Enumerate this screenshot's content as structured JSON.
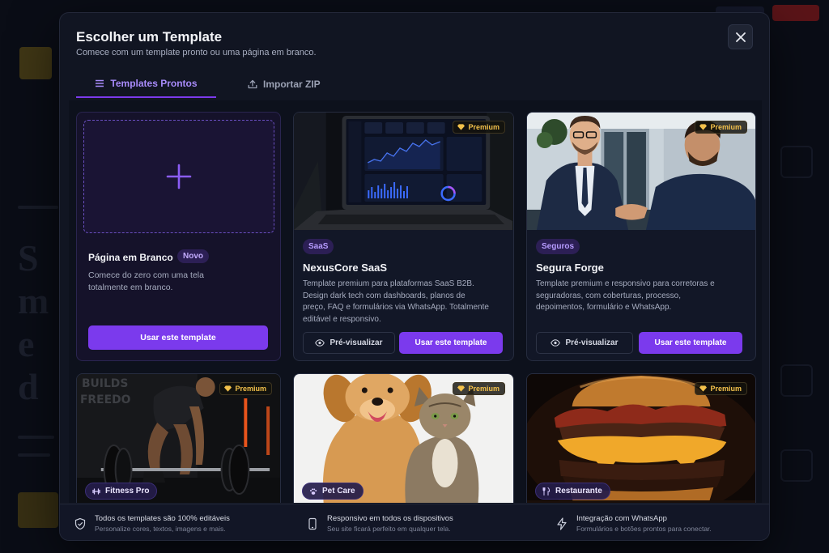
{
  "modal": {
    "title": "Escolher um Template",
    "subtitle": "Comece com um template pronto ou uma página em branco."
  },
  "tabs": [
    {
      "label": "Templates Prontos",
      "active": true,
      "icon": "list-icon"
    },
    {
      "label": "Importar ZIP",
      "active": false,
      "icon": "upload-icon"
    }
  ],
  "blank": {
    "title": "Página em Branco",
    "badge": "Novo",
    "description": "Comece do zero com uma tela totalmente em branco.",
    "button": "Usar este template"
  },
  "premium_label": "Premium",
  "cards": [
    {
      "category": "SaaS",
      "name": "NexusCore SaaS",
      "description": "Template premium para plataformas SaaS B2B. Design dark tech com dashboards, planos de preço, FAQ e formulários via WhatsApp. Totalmente editável e responsivo.",
      "preview": "Pré-visualizar",
      "use": "Usar este template"
    },
    {
      "category": "Seguros",
      "name": "Segura Forge",
      "description": "Template premium e responsivo para corretoras e seguradoras, com coberturas, processo, depoimentos, formulário e WhatsApp.",
      "preview": "Pré-visualizar",
      "use": "Usar este template"
    }
  ],
  "bottom_cards": [
    {
      "category": "Fitness Pro",
      "icon": "dumbbell-icon",
      "thumb_text": [
        "BUILDS",
        "FREEDO"
      ]
    },
    {
      "category": "Pet Care",
      "icon": "paw-icon"
    },
    {
      "category": "Restaurante",
      "icon": "utensils-icon"
    }
  ],
  "footer": [
    {
      "title": "Todos os templates são 100% editáveis",
      "subtitle": "Personalize cores, textos, imagens e mais.",
      "icon": "shield-icon"
    },
    {
      "title": "Responsivo em todos os dispositivos",
      "subtitle": "Seu site ficará perfeito em qualquer tela.",
      "icon": "phone-icon"
    },
    {
      "title": "Integração com WhatsApp",
      "subtitle": "Formulários e botões prontos para conectar.",
      "icon": "bolt-icon"
    }
  ],
  "colors": {
    "accent": "#7b3aed",
    "accent_text": "#a88bfa",
    "premium": "#f3c14b",
    "modal_bg": "#111522"
  }
}
